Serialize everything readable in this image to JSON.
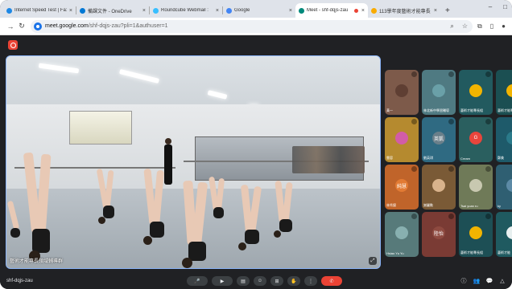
{
  "browser": {
    "tabs": [
      {
        "title": "Internet Speed Test | Fa:",
        "color": "#1e88e5"
      },
      {
        "title": "備課文件 - OneDrive",
        "color": "#0078d4"
      },
      {
        "title": "Roundcube Webmail :",
        "color": "#37beff"
      },
      {
        "title": "Google",
        "color": "#4285f4"
      },
      {
        "title": "Meet - shf-dqjs-zau",
        "color": "#00897b",
        "active": true
      },
      {
        "title": "113學年度藝術才能專長",
        "color": "#f9ab00"
      }
    ],
    "url_host": "meet.google.com",
    "url_path": "/shf-dqjs-zau?pli=1&authuser=1"
  },
  "main_video": {
    "name": "藝術才能專長領域輔導群"
  },
  "participants": [
    {
      "name": "黃一",
      "color": "#7d5a4a",
      "avatar_color": "#5f3f33",
      "initial": ""
    },
    {
      "name": "林北新中學習輔導",
      "color": "#4f7a82",
      "avatar_color": "#6aa0a8",
      "initial": ""
    },
    {
      "name": "藝術才能專長組",
      "color": "#225a5f",
      "avatar_color": "#f2b400",
      "initial": ""
    },
    {
      "name": "藝術才能專長",
      "color": "#1b4f52",
      "avatar_color": "#f2b400",
      "initial": ""
    },
    {
      "name": "雲容",
      "color": "#b58a2f",
      "avatar_color": "#d25ca7",
      "initial": ""
    },
    {
      "name": "劉英琪",
      "color": "#2f6a82",
      "avatar_color": "#6a7f8a",
      "initial": "英凱"
    },
    {
      "name": "Cream",
      "color": "#2a5f5f",
      "avatar_color": "#e8453c",
      "initial": "G"
    },
    {
      "name": "鄭美",
      "color": "#1e5a6a",
      "avatar_color": "#2a7a8a",
      "initial": ""
    },
    {
      "name": "林秀錦",
      "color": "#c0642a",
      "avatar_color": "#e27b34",
      "initial": "純慧"
    },
    {
      "name": "謝麗勳",
      "color": "#7a5a36",
      "avatar_color": "#d9b38c",
      "initial": ""
    },
    {
      "name": "Tsai yuan ru",
      "color": "#6f7a58",
      "avatar_color": "#c8c8b0",
      "initial": ""
    },
    {
      "name": "ky",
      "color": "#2f5f72",
      "avatar_color": "#5c8aa6",
      "initial": ""
    },
    {
      "name": "Hsiao Yu Yu",
      "color": "#577a7a",
      "avatar_color": "#88b0b0",
      "initial": ""
    },
    {
      "name": "",
      "color": "#7a3b34",
      "avatar_color": "#8e4a40",
      "initial": "陸怡"
    },
    {
      "name": "藝術才能專長組",
      "color": "#1d4f55",
      "avatar_color": "#f2b400",
      "initial": ""
    },
    {
      "name": "藝術才能",
      "color": "#1f5a60",
      "avatar_color": "#e8f0f0",
      "initial": ""
    }
  ],
  "bottom": {
    "meeting_code": "shf-dqjs-zau",
    "controls": [
      "mic",
      "camera",
      "captions",
      "emoji",
      "present",
      "raise-hand",
      "more",
      "end-call"
    ],
    "control_glyphs": [
      "🎤",
      "▶",
      "▤",
      "☺",
      "⊞",
      "✋",
      "⋮",
      "✆"
    ],
    "right_glyphs": [
      "ⓘ",
      "👥",
      "💬",
      "△"
    ]
  }
}
